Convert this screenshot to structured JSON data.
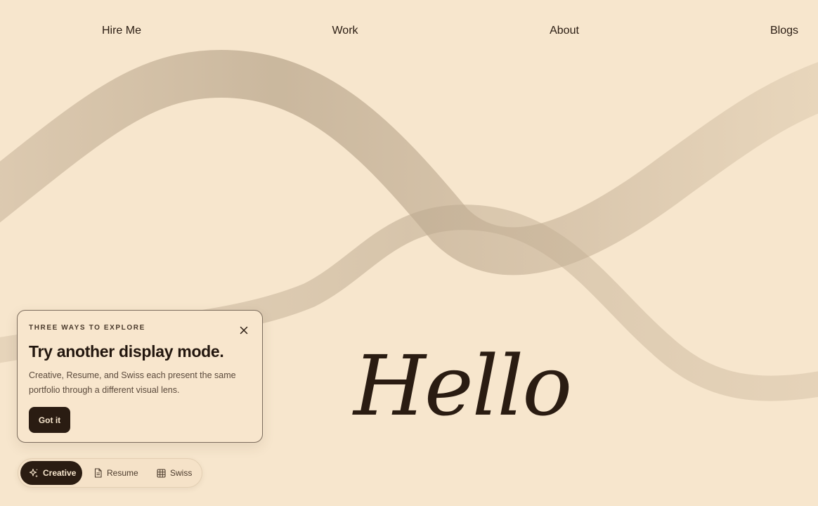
{
  "nav": {
    "items": [
      {
        "label": "Hire Me"
      },
      {
        "label": "Work"
      },
      {
        "label": "About"
      },
      {
        "label": "Blogs"
      }
    ]
  },
  "hero": {
    "greeting": "Hello"
  },
  "onboarding_card": {
    "eyebrow": "THREE WAYS TO EXPLORE",
    "title": "Try another display mode.",
    "description": "Creative, Resume, and Swiss each present the same portfolio through a different visual lens.",
    "button_label": "Got it",
    "close_icon": "close-icon"
  },
  "mode_switcher": {
    "active": "Creative",
    "modes": [
      {
        "label": "Creative",
        "icon": "sparkles-icon"
      },
      {
        "label": "Resume",
        "icon": "document-icon"
      },
      {
        "label": "Swiss",
        "icon": "grid-icon"
      }
    ]
  },
  "colors": {
    "background": "#f7e6cd",
    "ink": "#2a1c12",
    "ribbon": "#c4b096"
  }
}
